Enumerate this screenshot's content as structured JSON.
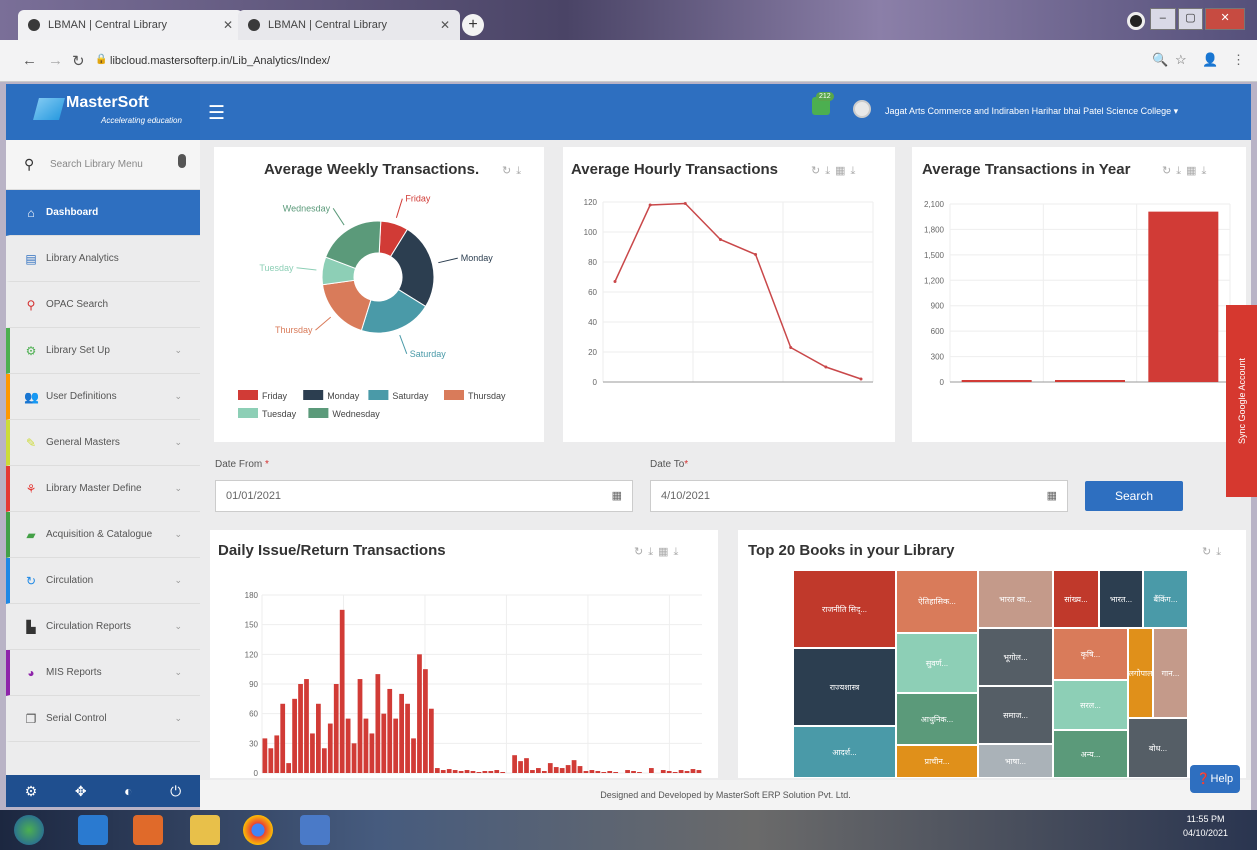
{
  "browser": {
    "tabs": [
      {
        "label": "LBMAN | Central Library"
      },
      {
        "label": "LBMAN | Central Library"
      }
    ],
    "url": "libcloud.mastersofterp.in/Lib_Analytics/Index/"
  },
  "app": {
    "logo": "MasterSoft",
    "logo_tagline": "Accelerating education",
    "notification_count": "212",
    "college_name": "Jagat Arts Commerce and Indiraben Harihar bhai Patel Science College"
  },
  "sidebar": {
    "search_placeholder": "Search Library Menu",
    "items": [
      {
        "label": "Dashboard"
      },
      {
        "label": "Library Analytics"
      },
      {
        "label": "OPAC Search"
      },
      {
        "label": "Library Set Up"
      },
      {
        "label": "User Definitions"
      },
      {
        "label": "General Masters"
      },
      {
        "label": "Library Master Define"
      },
      {
        "label": "Acquisition & Catalogue"
      },
      {
        "label": "Circulation"
      },
      {
        "label": "Circulation Reports"
      },
      {
        "label": "MIS Reports"
      },
      {
        "label": "Serial Control"
      }
    ]
  },
  "form": {
    "date_from_label": "Date From",
    "date_from_value": "01/01/2021",
    "date_to_label": "Date To",
    "date_to_value": "4/10/2021",
    "search_label": "Search"
  },
  "sync_label": "Sync Google Account",
  "help_label": "Help",
  "footer": "Designed and Developed by MasterSoft ERP Solution Pvt. Ltd.",
  "taskbar": {
    "time": "11:55 PM",
    "date": "04/10/2021"
  },
  "colors": {
    "primary": "#2e6fc0",
    "bar": "#d13b36",
    "line": "#c9484a"
  },
  "chart_data": [
    {
      "type": "pie",
      "title": "Average Weekly Transactions.",
      "categories": [
        "Friday",
        "Monday",
        "Saturday",
        "Thursday",
        "Tuesday",
        "Wednesday"
      ],
      "values": [
        8,
        25,
        21,
        18,
        8,
        20
      ],
      "colors": [
        "#d13b36",
        "#2c3e50",
        "#4a9aa8",
        "#d97b5a",
        "#8dcfb6",
        "#5b9a7a"
      ]
    },
    {
      "type": "line",
      "title": "Average Hourly Transactions",
      "x": [
        1,
        2,
        3,
        4,
        5,
        6,
        7,
        8
      ],
      "values": [
        67,
        118,
        119,
        95,
        85,
        23,
        10,
        2
      ],
      "ylim": [
        0,
        120
      ],
      "yticks": [
        0,
        20,
        40,
        60,
        80,
        100,
        120
      ]
    },
    {
      "type": "bar",
      "title": "Average Transactions in Year",
      "values": [
        20,
        10,
        2010
      ],
      "ylim": [
        0,
        2100
      ],
      "yticks": [
        "0",
        "300",
        "600",
        "900",
        "1,200",
        "1,500",
        "1,800",
        "2,100"
      ]
    },
    {
      "type": "bar",
      "title": "Daily Issue/Return Transactions",
      "ylim": [
        0,
        180
      ],
      "yticks": [
        0,
        30,
        60,
        90,
        120,
        150,
        180
      ],
      "values": [
        35,
        25,
        38,
        70,
        10,
        75,
        90,
        95,
        40,
        70,
        25,
        50,
        90,
        165,
        55,
        30,
        95,
        55,
        40,
        100,
        60,
        85,
        55,
        80,
        70,
        35,
        120,
        105,
        65,
        5,
        3,
        4,
        3,
        2,
        3,
        2,
        1,
        2,
        2,
        3,
        1,
        0,
        18,
        12,
        15,
        3,
        5,
        2,
        10,
        6,
        5,
        8,
        13,
        7,
        2,
        3,
        2,
        1,
        2,
        1,
        0,
        3,
        2,
        1,
        0,
        5,
        0,
        3,
        2,
        1,
        3,
        2,
        4,
        3
      ]
    },
    {
      "type": "treemap",
      "title": "Top 20 Books in your Library",
      "labels": [
        "राजनीति सिद्...",
        "ऐतिहासिक...",
        "भारत का...",
        "सांख्य...",
        "भारत...",
        "बैंकिंग...",
        "सुवर्ण...",
        "भूगोल...",
        "कृषि...",
        "बालगोपाल...",
        "गान...",
        "राज्यशास्त्र",
        "आधुनिक...",
        "समाज...",
        "सरल...",
        "आदर्श...",
        "प्राचीन...",
        "भाषा...",
        "अन्य...",
        "बोध..."
      ]
    }
  ]
}
